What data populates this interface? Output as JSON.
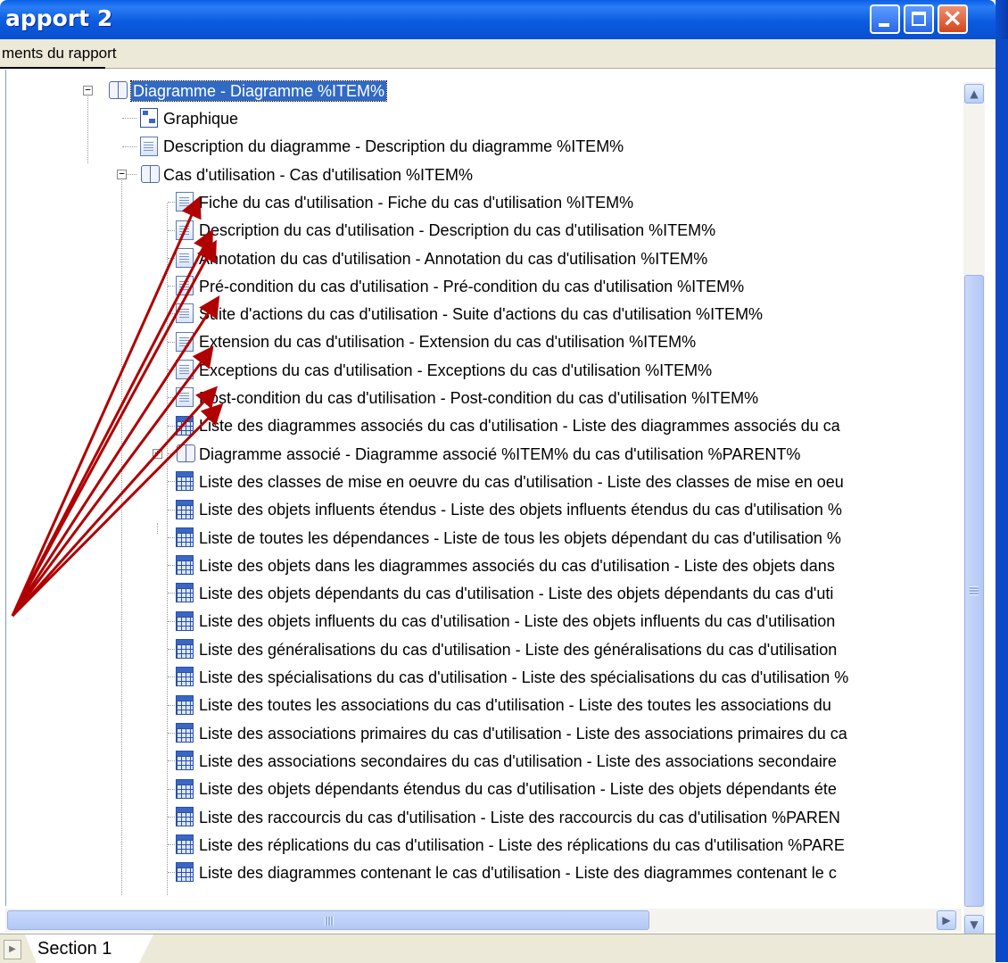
{
  "window": {
    "title": "apport 2",
    "menu_text": "ments du rapport",
    "controls": [
      "minimize",
      "maximize",
      "close"
    ]
  },
  "tree": {
    "items": [
      {
        "label": "Diagramme - Diagramme %ITEM%",
        "icon": "book-icon",
        "level": 0,
        "expander": "minus",
        "selected": true
      },
      {
        "label": "Graphique",
        "icon": "graph-icon",
        "level": 1
      },
      {
        "label": "Description du diagramme - Description du diagramme %ITEM%",
        "icon": "document-icon",
        "level": 1
      },
      {
        "label": "Cas d'utilisation - Cas d'utilisation %ITEM%",
        "icon": "book-icon",
        "level": 1,
        "expander": "minus"
      },
      {
        "label": "Fiche du cas d'utilisation - Fiche du cas d'utilisation %ITEM%",
        "icon": "document-icon",
        "level": 2
      },
      {
        "label": "Description du cas d'utilisation - Description du cas d'utilisation %ITEM%",
        "icon": "document-icon",
        "level": 2
      },
      {
        "label": "Annotation du cas d'utilisation - Annotation du cas d'utilisation %ITEM%",
        "icon": "document-icon",
        "level": 2
      },
      {
        "label": "Pré-condition du cas d'utilisation - Pré-condition du cas d'utilisation %ITEM%",
        "icon": "document-icon",
        "level": 2
      },
      {
        "label": "Suite d'actions du cas d'utilisation - Suite d'actions du cas d'utilisation %ITEM%",
        "icon": "document-icon",
        "level": 2
      },
      {
        "label": "Extension du cas d'utilisation - Extension du cas d'utilisation %ITEM%",
        "icon": "document-icon",
        "level": 2
      },
      {
        "label": "Exceptions du cas d'utilisation - Exceptions du cas d'utilisation %ITEM%",
        "icon": "document-icon",
        "level": 2
      },
      {
        "label": "Post-condition du cas d'utilisation - Post-condition du cas d'utilisation %ITEM%",
        "icon": "document-icon",
        "level": 2
      },
      {
        "label": "Liste des diagrammes associés du cas d'utilisation - Liste des diagrammes associés du ca",
        "icon": "grid-icon",
        "level": 2
      },
      {
        "label": "Diagramme associé - Diagramme associé %ITEM% du cas d'utilisation %PARENT%",
        "icon": "book-icon",
        "level": 2,
        "expander": "plus"
      },
      {
        "label": "Liste des classes de mise en oeuvre du cas d'utilisation - Liste des classes de mise en oeu",
        "icon": "grid-icon",
        "level": 2
      },
      {
        "label": "Liste des objets influents étendus - Liste des objets influents étendus du cas d'utilisation %",
        "icon": "grid-icon",
        "level": 2
      },
      {
        "label": "Liste de toutes les dépendances - Liste de tous les objets dépendant du cas d'utilisation %",
        "icon": "grid-icon",
        "level": 2
      },
      {
        "label": "Liste des objets dans les diagrammes associés du cas d'utilisation - Liste des objets dans",
        "icon": "grid-icon",
        "level": 2
      },
      {
        "label": "Liste des objets dépendants du cas d'utilisation - Liste des objets dépendants du cas d'uti",
        "icon": "grid-icon",
        "level": 2
      },
      {
        "label": "Liste des objets influents du cas d'utilisation - Liste des objets influents du cas d'utilisation",
        "icon": "grid-icon",
        "level": 2
      },
      {
        "label": "Liste des généralisations du cas d'utilisation - Liste des généralisations du cas d'utilisation",
        "icon": "grid-icon",
        "level": 2
      },
      {
        "label": "Liste des spécialisations du cas d'utilisation - Liste des spécialisations du cas d'utilisation %",
        "icon": "grid-icon",
        "level": 2
      },
      {
        "label": "Liste des toutes les associations du cas d'utilisation - Liste des toutes les associations du",
        "icon": "grid-icon",
        "level": 2
      },
      {
        "label": "Liste des associations primaires du cas d'utilisation - Liste des associations primaires du ca",
        "icon": "grid-icon",
        "level": 2
      },
      {
        "label": "Liste des associations secondaires du cas d'utilisation - Liste des associations secondaire",
        "icon": "grid-icon",
        "level": 2
      },
      {
        "label": "Liste des objets dépendants étendus du cas d'utilisation - Liste des objets dépendants éte",
        "icon": "grid-icon",
        "level": 2
      },
      {
        "label": "Liste des raccourcis du cas d'utilisation - Liste des raccourcis du cas d'utilisation %PAREN",
        "icon": "grid-icon",
        "level": 2
      },
      {
        "label": "Liste des réplications du cas d'utilisation - Liste des réplications du cas d'utilisation %PARE",
        "icon": "grid-icon",
        "level": 2
      },
      {
        "label": "Liste des diagrammes contenant le cas d'utilisation - Liste des diagrammes contenant le c",
        "icon": "grid-icon",
        "level": 2
      }
    ]
  },
  "tabs": [
    {
      "label": "Section 1"
    }
  ],
  "colors": {
    "annotation_arrow": "#b00000",
    "selection": "#316ac5",
    "titlebar": "#0a5fe6"
  }
}
